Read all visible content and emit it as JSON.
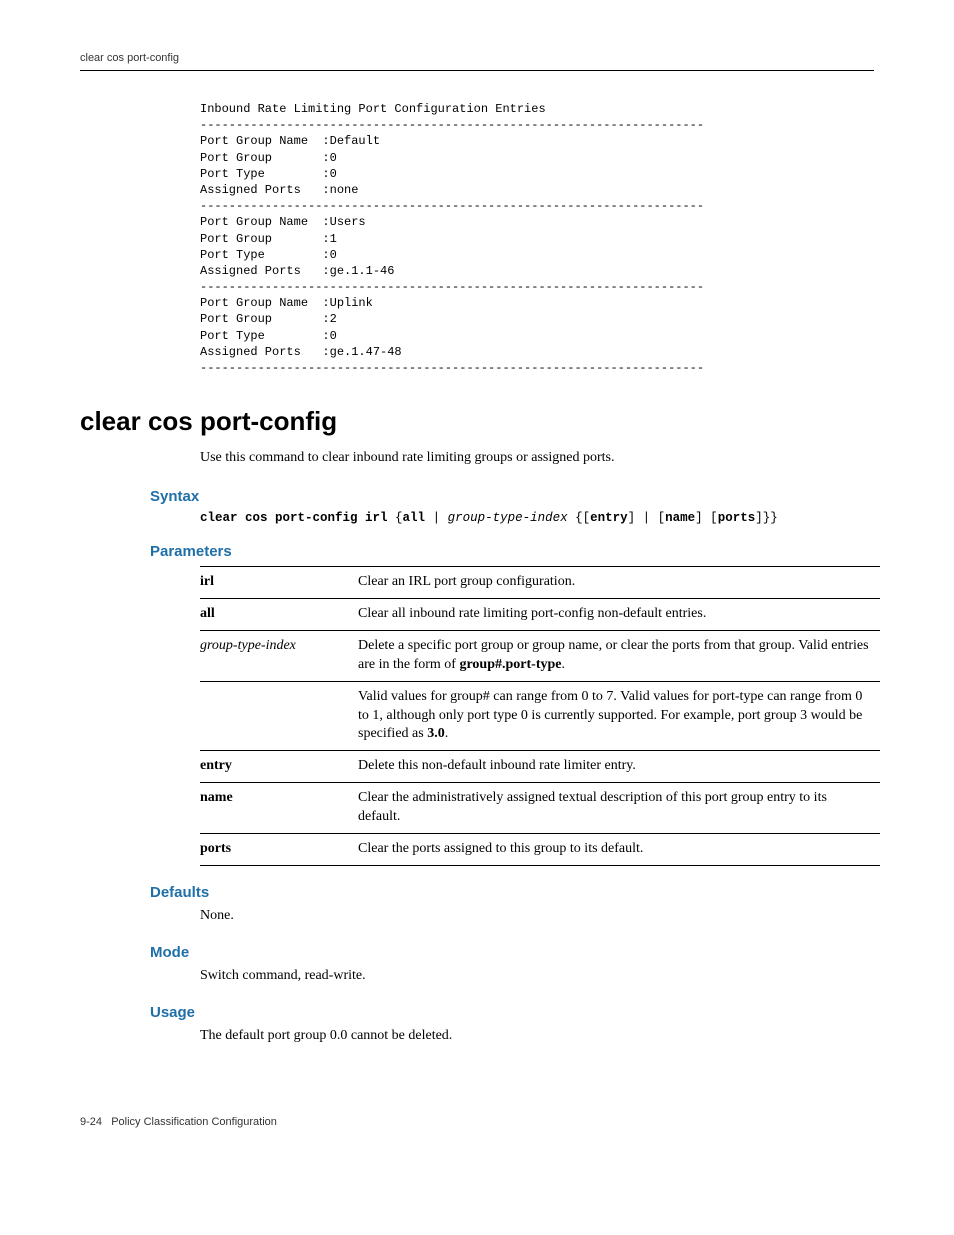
{
  "header": {
    "running_title": "clear cos port-config"
  },
  "code_block_lines": [
    "Inbound Rate Limiting Port Configuration Entries",
    "----------------------------------------------------------------------",
    "Port Group Name  :Default",
    "Port Group       :0",
    "Port Type        :0",
    "Assigned Ports   :none",
    "----------------------------------------------------------------------",
    "Port Group Name  :Users",
    "Port Group       :1",
    "Port Type        :0",
    "Assigned Ports   :ge.1.1-46",
    "----------------------------------------------------------------------",
    "Port Group Name  :Uplink",
    "Port Group       :2",
    "Port Type        :0",
    "Assigned Ports   :ge.1.47-48",
    "----------------------------------------------------------------------"
  ],
  "section": {
    "title": "clear cos port-config",
    "intro": "Use this command to clear inbound rate limiting groups or assigned ports."
  },
  "syntax": {
    "heading": "Syntax",
    "cmd_bold1": "clear cos port-config irl",
    "brace_open": " {",
    "all": "all",
    "pipe1": " | ",
    "gti": "group-type-index",
    "seg_open": " {[",
    "entry": "entry",
    "seg_mid1": "] | [",
    "name": "name",
    "seg_mid2": "] [",
    "ports": "ports",
    "seg_close": "]}}"
  },
  "parameters": {
    "heading": "Parameters",
    "rows": {
      "irl": {
        "name": "irl",
        "desc": "Clear an IRL port group configuration."
      },
      "all": {
        "name": "all",
        "desc": "Clear all inbound rate limiting port-config non-default entries."
      },
      "gti": {
        "name": "group-type-index",
        "desc_pre": "Delete a specific port group or group name, or clear the ports from that group. Valid entries are in the form of ",
        "desc_bold": "group#.port-type",
        "desc_post": ".",
        "desc2_pre": "Valid values for group# can range from 0 to 7. Valid values for port-type can range from 0 to 1, although only port type 0 is currently supported. For example, port group 3 would be specified as ",
        "desc2_bold": "3.0",
        "desc2_post": "."
      },
      "entry": {
        "name": "entry",
        "desc": "Delete this non-default inbound rate limiter entry."
      },
      "nameparam": {
        "name": "name",
        "desc": "Clear the administratively assigned textual description of this port group entry to its default."
      },
      "portsparam": {
        "name": "ports",
        "desc": "Clear the ports assigned to this group to its default."
      }
    }
  },
  "defaults": {
    "heading": "Defaults",
    "text": "None."
  },
  "mode": {
    "heading": "Mode",
    "text": "Switch command, read-write."
  },
  "usage": {
    "heading": "Usage",
    "text": "The default port group 0.0 cannot be deleted."
  },
  "footer": {
    "page": "9-24",
    "label": "Policy Classification Configuration"
  }
}
